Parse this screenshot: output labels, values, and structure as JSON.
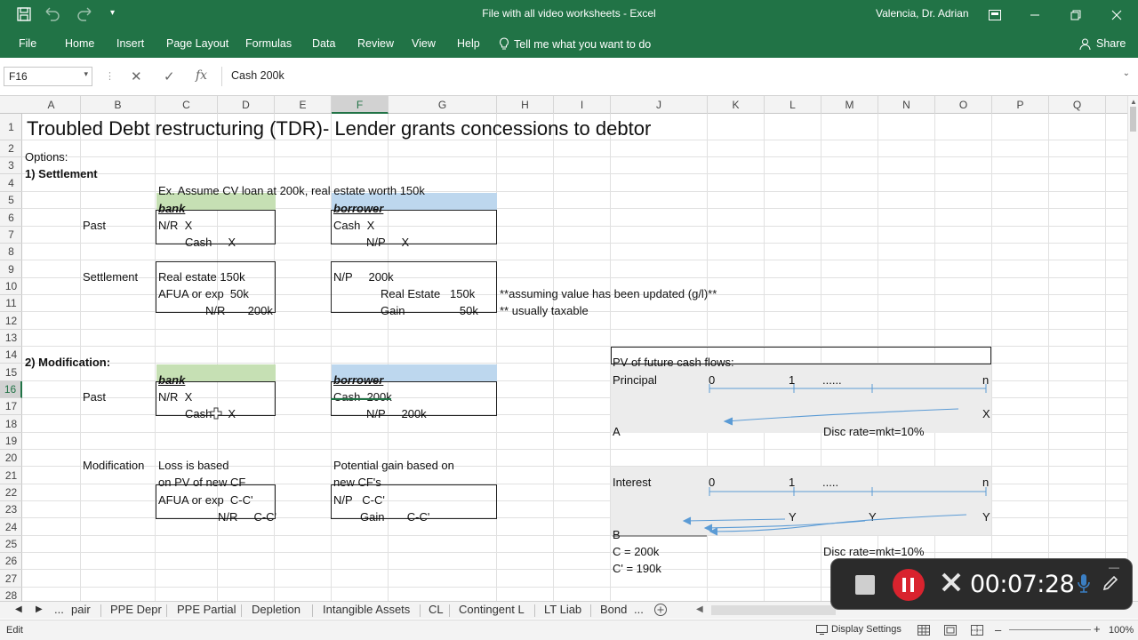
{
  "window": {
    "title": "File with all video worksheets  -  Excel",
    "user": "Valencia, Dr. Adrian"
  },
  "ribbon": {
    "tabs": [
      "File",
      "Home",
      "Insert",
      "Page Layout",
      "Formulas",
      "Data",
      "Review",
      "View",
      "Help"
    ],
    "tell_me": "Tell me what you want to do",
    "share": "Share"
  },
  "formula_bar": {
    "name_box": "F16",
    "fx": "fx",
    "content": "Cash  200k"
  },
  "grid": {
    "columns": [
      "A",
      "B",
      "C",
      "D",
      "E",
      "F",
      "G",
      "H",
      "I",
      "J",
      "K",
      "L",
      "M",
      "N",
      "O",
      "P",
      "Q"
    ],
    "rows": [
      "1",
      "2",
      "3",
      "4",
      "5",
      "6",
      "7",
      "8",
      "9",
      "10",
      "11",
      "12",
      "13",
      "14",
      "15",
      "16",
      "17",
      "18",
      "19",
      "20",
      "21",
      "22",
      "23",
      "24",
      "25",
      "26",
      "27",
      "28"
    ],
    "selected_column": "F",
    "selected_row": "16"
  },
  "sheet": {
    "title": "Troubled Debt restructuring (TDR)- Lender grants concessions to debtor",
    "options": "Options:",
    "settlement_heading": "1) Settlement",
    "example": "Ex. Assume CV loan at 200k, real estate worth 150k",
    "bank": "bank",
    "borrower": "borrower",
    "past": "Past",
    "bank_nr_x": "N/R  X",
    "bank_cash_x": "Cash     X",
    "borrower_cash_x": "Cash  X",
    "borrower_np_x": "N/P     X",
    "settlement": "Settlement",
    "real_estate_150k": "Real estate 150k",
    "afua_50k": "AFUA or exp  50k",
    "nr_200k": "N/R       200k",
    "np_200k": "N/P     200k",
    "real_estate_cr": "Real Estate   150k",
    "gain_50k": "Gain                 50k",
    "note_value": "**assuming value has been updated (g/l)**",
    "note_taxable": "** usually taxable",
    "modification_heading": "2) Modification:",
    "bank2": "bank",
    "borrower2": "borrower",
    "past2": "Past",
    "bank2_nr_x": "N/R  X",
    "bank2_cash_x": "Cash     X",
    "borrower2_cash": "Cash  200k",
    "borrower2_np": "N/P     200k",
    "modification": "Modification",
    "loss_based": "Loss is based",
    "on_pv": "on PV of new CF",
    "afua_cc": "AFUA or exp  C-C'",
    "nr_cc": "N/R     C-C'",
    "potential_gain": "Potential gain based on",
    "new_cfs": "new CF's",
    "np_cc": "N/P   C-C'",
    "gain_cc": "Gain       C-C'",
    "pv_title": "PV of future cash flows:",
    "principal": "Principal",
    "p_0": "0",
    "p_1": "1",
    "p_dots": "......",
    "p_n": "n",
    "p_x": "X",
    "a_label": "A",
    "disc1": "Disc rate=mkt=10%",
    "interest": "Interest",
    "i_0": "0",
    "i_1": "1",
    "i_dots": ".....",
    "i_n": "n",
    "y1": "Y",
    "y2": "Y",
    "y3": "Y",
    "b_label": "B",
    "c_200k": "C = 200k",
    "c_190k": "C' = 190k",
    "disc2": "Disc rate=mkt=10%"
  },
  "sheet_tabs": {
    "left_more": "...",
    "tabs": [
      "pair",
      "PPE Depr",
      "PPE Partial",
      "Depletion",
      "Intangible Assets",
      "CL",
      "Contingent L",
      "LT Liab",
      "Bond"
    ],
    "right_more": "..."
  },
  "status": {
    "mode": "Edit",
    "display_settings": "Display Settings",
    "zoom": "100%"
  },
  "recorder": {
    "time": "00:07:28"
  },
  "colors": {
    "excel_green": "#217346",
    "bank_fill": "#c6e0b4",
    "borrower_fill": "#bdd7ee",
    "arrow_blue": "#5b9bd5",
    "record_red": "#d9232e"
  }
}
